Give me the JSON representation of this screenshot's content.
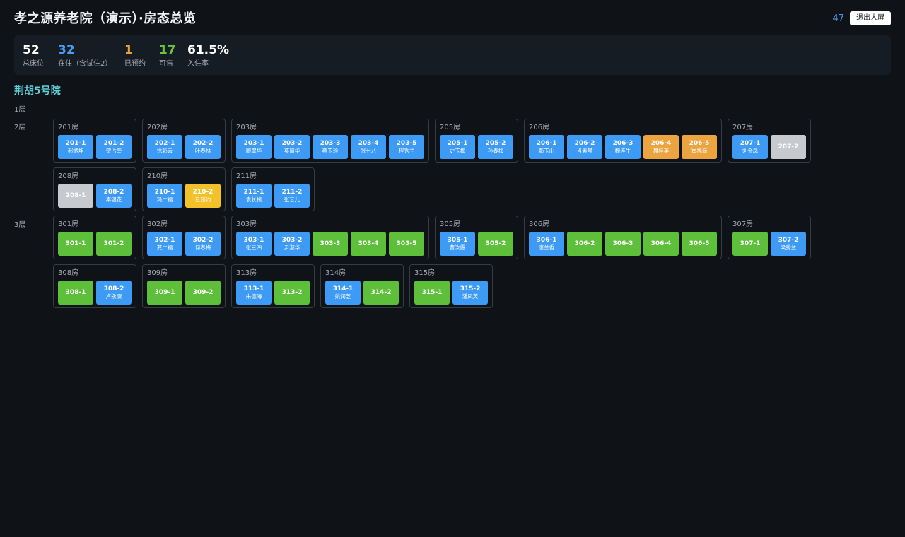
{
  "header": {
    "title": "孝之源养老院（演示）·房态总览",
    "counter": "47",
    "exit_label": "退出大屏"
  },
  "stats": [
    {
      "value": "52",
      "label": "总床位",
      "color": "#ffffff"
    },
    {
      "value": "32",
      "label": "在住（含试住2）",
      "color": "#4a9cf0"
    },
    {
      "value": "1",
      "label": "已预约",
      "color": "#e9a03c"
    },
    {
      "value": "17",
      "label": "可售",
      "color": "#6cc33f"
    },
    {
      "value": "61.5%",
      "label": "入住率",
      "color": "#ffffff"
    }
  ],
  "status_colors": {
    "occupied": "#3d9af5",
    "available": "#5ebf3a",
    "trial": "#eba43f",
    "reserved": "#f3c12a",
    "disabled": "#c6c9ce"
  },
  "campus": {
    "name": "荆胡5号院",
    "floors": [
      {
        "label": "1层",
        "rooms": []
      },
      {
        "label": "2层",
        "rooms": [
          {
            "name": "201房",
            "beds": [
              {
                "code": "201-1",
                "name": "郝炳坤",
                "status": "occupied"
              },
              {
                "code": "201-2",
                "name": "贺占奎",
                "status": "occupied"
              }
            ]
          },
          {
            "name": "202房",
            "beds": [
              {
                "code": "202-1",
                "name": "徐彩云",
                "status": "occupied"
              },
              {
                "code": "202-2",
                "name": "叶春林",
                "status": "occupied"
              }
            ]
          },
          {
            "name": "203房",
            "beds": [
              {
                "code": "203-1",
                "name": "廖翠华",
                "status": "occupied"
              },
              {
                "code": "203-2",
                "name": "莫丽华",
                "status": "occupied"
              },
              {
                "code": "203-3",
                "name": "蔡玉珍",
                "status": "occupied"
              },
              {
                "code": "203-4",
                "name": "张七八",
                "status": "occupied"
              },
              {
                "code": "203-5",
                "name": "程秀兰",
                "status": "occupied"
              }
            ]
          },
          {
            "name": "205房",
            "beds": [
              {
                "code": "205-1",
                "name": "史玉梅",
                "status": "occupied"
              },
              {
                "code": "205-2",
                "name": "孙春梅",
                "status": "occupied"
              }
            ]
          },
          {
            "name": "206房",
            "beds": [
              {
                "code": "206-1",
                "name": "彭玉山",
                "status": "occupied"
              },
              {
                "code": "206-2",
                "name": "肖素琴",
                "status": "occupied"
              },
              {
                "code": "206-3",
                "name": "魏连生",
                "status": "occupied"
              },
              {
                "code": "206-4",
                "name": "聂桂英",
                "status": "trial"
              },
              {
                "code": "206-5",
                "name": "崔福海",
                "status": "trial"
              }
            ]
          },
          {
            "name": "207房",
            "beds": [
              {
                "code": "207-1",
                "name": "刘金凤",
                "status": "occupied"
              },
              {
                "code": "207-2",
                "name": "",
                "status": "disabled"
              }
            ]
          },
          {
            "name": "208房",
            "beds": [
              {
                "code": "208-1",
                "name": "",
                "status": "disabled"
              },
              {
                "code": "208-2",
                "name": "秦银花",
                "status": "occupied"
              }
            ]
          },
          {
            "name": "210房",
            "beds": [
              {
                "code": "210-1",
                "name": "冯广福",
                "status": "occupied"
              },
              {
                "code": "210-2",
                "name": "已预约",
                "status": "reserved"
              }
            ]
          },
          {
            "name": "211房",
            "beds": [
              {
                "code": "211-1",
                "name": "袁长根",
                "status": "occupied"
              },
              {
                "code": "211-2",
                "name": "张艺儿",
                "status": "occupied"
              }
            ]
          }
        ]
      },
      {
        "label": "3层",
        "rooms": [
          {
            "name": "301房",
            "beds": [
              {
                "code": "301-1",
                "name": "",
                "status": "available"
              },
              {
                "code": "301-2",
                "name": "",
                "status": "available"
              }
            ]
          },
          {
            "name": "302房",
            "beds": [
              {
                "code": "302-1",
                "name": "龚广福",
                "status": "occupied"
              },
              {
                "code": "302-2",
                "name": "何春梅",
                "status": "occupied"
              }
            ]
          },
          {
            "name": "303房",
            "beds": [
              {
                "code": "303-1",
                "name": "张三四",
                "status": "occupied"
              },
              {
                "code": "303-2",
                "name": "尹淑华",
                "status": "occupied"
              },
              {
                "code": "303-3",
                "name": "",
                "status": "available"
              },
              {
                "code": "303-4",
                "name": "",
                "status": "available"
              },
              {
                "code": "303-5",
                "name": "",
                "status": "available"
              }
            ]
          },
          {
            "name": "305房",
            "beds": [
              {
                "code": "305-1",
                "name": "曹汝霞",
                "status": "occupied"
              },
              {
                "code": "305-2",
                "name": "",
                "status": "available"
              }
            ]
          },
          {
            "name": "306房",
            "beds": [
              {
                "code": "306-1",
                "name": "唐兰香",
                "status": "occupied"
              },
              {
                "code": "306-2",
                "name": "",
                "status": "available"
              },
              {
                "code": "306-3",
                "name": "",
                "status": "available"
              },
              {
                "code": "306-4",
                "name": "",
                "status": "available"
              },
              {
                "code": "306-5",
                "name": "",
                "status": "available"
              }
            ]
          },
          {
            "name": "307房",
            "beds": [
              {
                "code": "307-1",
                "name": "",
                "status": "available"
              },
              {
                "code": "307-2",
                "name": "梁秀兰",
                "status": "occupied"
              }
            ]
          },
          {
            "name": "308房",
            "beds": [
              {
                "code": "308-1",
                "name": "",
                "status": "available"
              },
              {
                "code": "308-2",
                "name": "卢永康",
                "status": "occupied"
              }
            ]
          },
          {
            "name": "309房",
            "beds": [
              {
                "code": "309-1",
                "name": "",
                "status": "available"
              },
              {
                "code": "309-2",
                "name": "",
                "status": "available"
              }
            ]
          },
          {
            "name": "313房",
            "beds": [
              {
                "code": "313-1",
                "name": "朱德海",
                "status": "occupied"
              },
              {
                "code": "313-2",
                "name": "",
                "status": "available"
              }
            ]
          },
          {
            "name": "314房",
            "beds": [
              {
                "code": "314-1",
                "name": "姚润芝",
                "status": "occupied"
              },
              {
                "code": "314-2",
                "name": "",
                "status": "available"
              }
            ]
          },
          {
            "name": "315房",
            "beds": [
              {
                "code": "315-1",
                "name": "",
                "status": "available"
              },
              {
                "code": "315-2",
                "name": "潘凤英",
                "status": "occupied"
              }
            ]
          }
        ]
      }
    ]
  }
}
